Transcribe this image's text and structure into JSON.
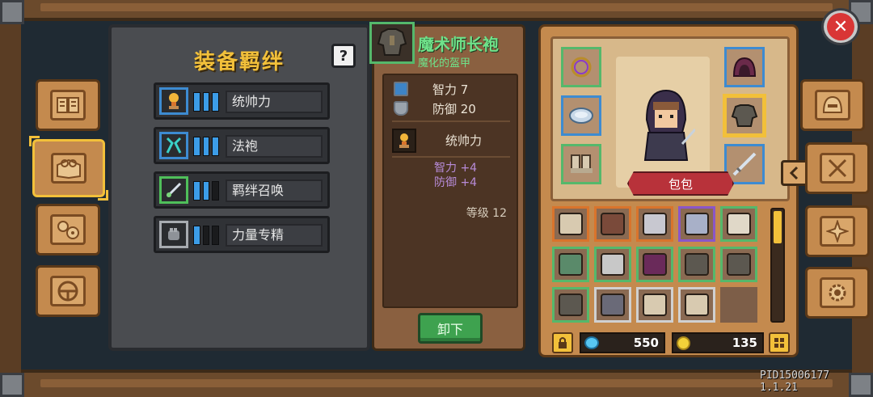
{
  "bond_panel": {
    "title": "装备羁绊",
    "help_label": "?",
    "bonds": [
      {
        "label": "统帅力",
        "bars": 3,
        "bars_on": 3,
        "icon": "trophy-icon",
        "rarity": "blue"
      },
      {
        "label": "法袍",
        "bars": 3,
        "bars_on": 3,
        "icon": "robe-icon",
        "rarity": "blue"
      },
      {
        "label": "羁绊召唤",
        "bars": 3,
        "bars_on": 2,
        "icon": "summon-sword-icon",
        "rarity": "green"
      },
      {
        "label": "力量专精",
        "bars": 3,
        "bars_on": 1,
        "icon": "fist-icon",
        "rarity": "gray"
      }
    ]
  },
  "item_detail": {
    "name": "魔术师长袍",
    "subtitle": "魔化的盔甲",
    "stats": [
      {
        "label": "智力 7",
        "icon": "book-icon"
      },
      {
        "label": "防御 20",
        "icon": "shield-icon"
      }
    ],
    "skill": {
      "label": "统帅力",
      "icon": "trophy-icon"
    },
    "bonuses": [
      "智力 +4",
      "防御 +4"
    ],
    "level": "等级 12",
    "unequip_label": "卸下"
  },
  "character": {
    "bag_label": "包包",
    "currency": {
      "gems": "550",
      "gold": "135"
    }
  },
  "inventory": {
    "rarities": [
      "orange",
      "orange",
      "orange",
      "purple",
      "green",
      "green",
      "green",
      "green",
      "green",
      "green",
      "green",
      "white",
      "white",
      "white",
      "empty"
    ],
    "icons": [
      "crossbow-icon",
      "helmet-icon",
      "boots-icon",
      "armor-icon",
      "pickaxe-icon",
      "scroll-icon",
      "axe-icon",
      "hood-icon",
      "robe-icon",
      "robe-icon",
      "robe-icon",
      "gauntlet-icon",
      "crossbow-icon",
      "crossbow-icon",
      "empty-slot"
    ],
    "scroll_position": 0.0
  },
  "footer": {
    "pid": "PID15006177  1.1.21"
  },
  "colors": {
    "accent_gold": "#f2c03a",
    "rarity_green": "#55b86b",
    "rarity_blue": "#3d8bd1",
    "item_name_green": "#6fe28a",
    "bonus_purple": "#b78bd8",
    "close_red": "#d93636"
  }
}
